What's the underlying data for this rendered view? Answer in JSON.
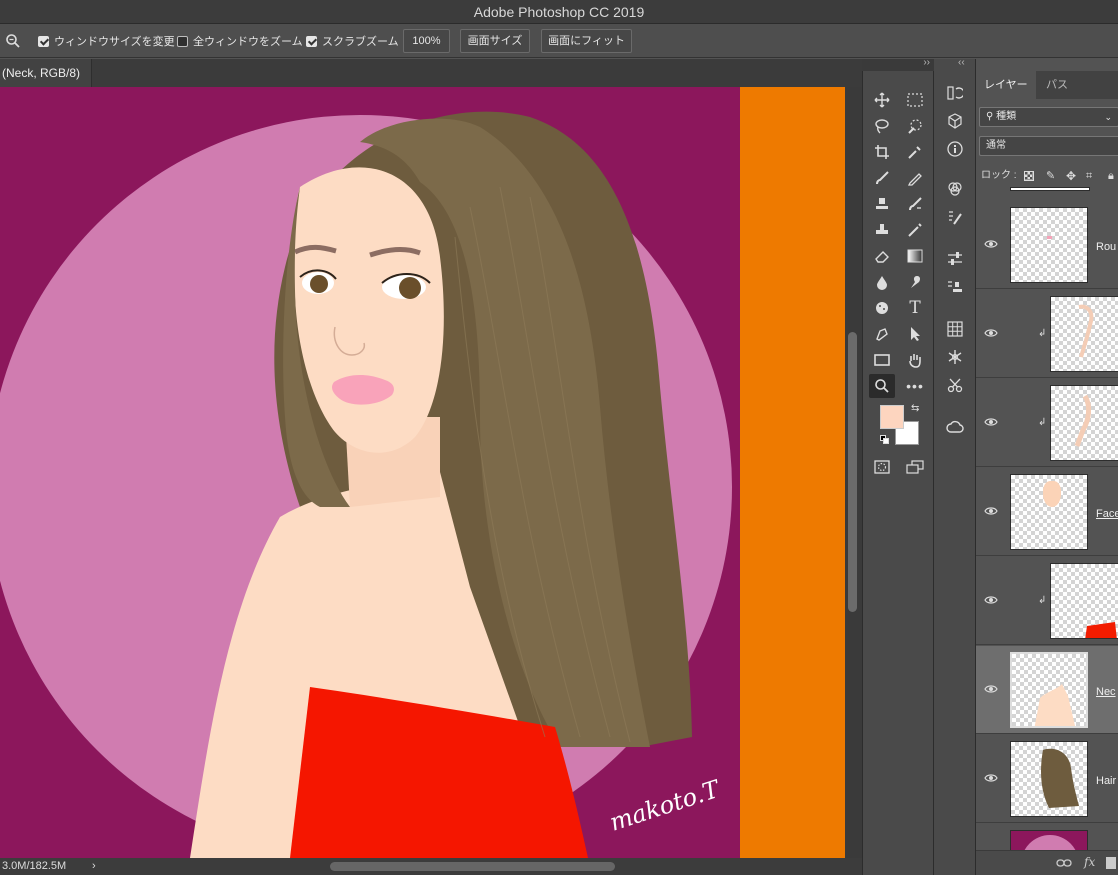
{
  "app": {
    "title": "Adobe Photoshop CC 2019"
  },
  "options_bar": {
    "resize_windows": {
      "label": "ウィンドウサイズを変更",
      "checked": true
    },
    "zoom_all_windows": {
      "label": "全ウィンドウをズーム",
      "checked": false
    },
    "scrubby_zoom": {
      "label": "スクラブズーム",
      "checked": true
    },
    "zoom_value": "100%",
    "actual_pixels_label": "画面サイズ",
    "fit_screen_label": "画面にフィット"
  },
  "document": {
    "tab_label": "(Neck, RGB/8)",
    "signature": "makoto.T"
  },
  "status_bar": {
    "doc_size": "3.0M/182.5M",
    "arrow": "›"
  },
  "tools": {
    "selected": "zoom-tool",
    "foreground_color": "#fdd5bf",
    "background_color": "#ffffff"
  },
  "layers_panel": {
    "tabs": [
      "レイヤー",
      "パス"
    ],
    "filter_label": "種類",
    "blend_mode": "通常",
    "lock_label": "ロック :",
    "layers": [
      {
        "name": "Rou",
        "visible": true,
        "clipped": false,
        "selected": false
      },
      {
        "name": "",
        "visible": true,
        "clipped": true,
        "selected": false
      },
      {
        "name": "",
        "visible": true,
        "clipped": true,
        "selected": false
      },
      {
        "name": "Face",
        "visible": true,
        "clipped": false,
        "selected": false
      },
      {
        "name": "",
        "visible": true,
        "clipped": true,
        "selected": false
      },
      {
        "name": "Nec",
        "visible": true,
        "clipped": false,
        "selected": true
      },
      {
        "name": "Hair",
        "visible": true,
        "clipped": false,
        "selected": false
      }
    ],
    "footer_fx": "fx"
  },
  "colors": {
    "canvas_background": "#8c175c",
    "circle": "#d07cb0",
    "orange_bar": "#ee7a00",
    "hair": "#7c6a4a",
    "skin": "#fddcc4",
    "dress": "#f51600",
    "lips": "#f9a3ba"
  }
}
